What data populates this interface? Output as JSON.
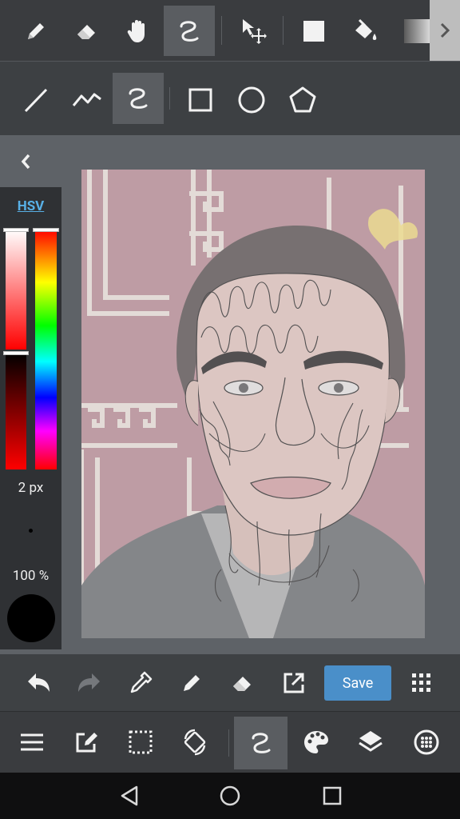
{
  "toolbar_top": {
    "tools": [
      "pencil-icon",
      "eraser-icon",
      "hand-icon",
      "lasso-icon",
      "move-icon",
      "fill-rect-icon",
      "bucket-icon",
      "gradient-icon"
    ],
    "more_label": ">"
  },
  "shape_toolbar": {
    "tools": [
      "line-icon",
      "polyline-icon",
      "curve-icon",
      "rectangle-icon",
      "circle-icon",
      "pentagon-icon"
    ]
  },
  "color_panel": {
    "mode_label": "HSV",
    "brush_size": "2 px",
    "opacity": "100 %",
    "current_color": "#000000"
  },
  "bottom_toolbar": {
    "save_label": "Save",
    "tools": [
      "undo-icon",
      "redo-icon",
      "eyedropper-icon",
      "pen-icon",
      "eraser-icon",
      "export-icon",
      "save-button",
      "grid-icon"
    ]
  },
  "menu_toolbar": {
    "tools": [
      "menu-icon",
      "edit-icon",
      "selection-icon",
      "rotate-icon",
      "lasso-icon",
      "palette-icon",
      "layers-icon",
      "settings-icon"
    ]
  },
  "navbar": {
    "buttons": [
      "back-icon",
      "home-icon",
      "recents-icon"
    ]
  }
}
